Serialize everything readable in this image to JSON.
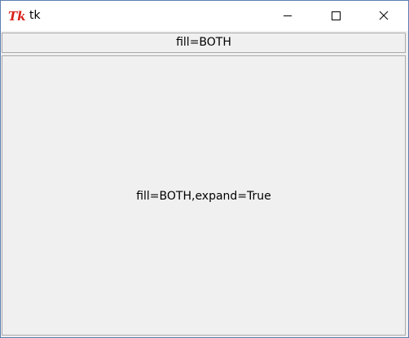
{
  "window": {
    "title": "tk",
    "app_icon": "tk-feather-icon",
    "controls": {
      "minimize": "minimize-icon",
      "maximize": "maximize-icon",
      "close": "close-icon"
    }
  },
  "labels": {
    "top": "fill=BOTH",
    "main": "fill=BOTH,expand=True"
  },
  "colors": {
    "window_border": "#5b7fb0",
    "background": "#f0f0f0",
    "titlebar": "#ffffff",
    "icon_red": "#d9211a",
    "label_border": "#a9a9a9"
  }
}
